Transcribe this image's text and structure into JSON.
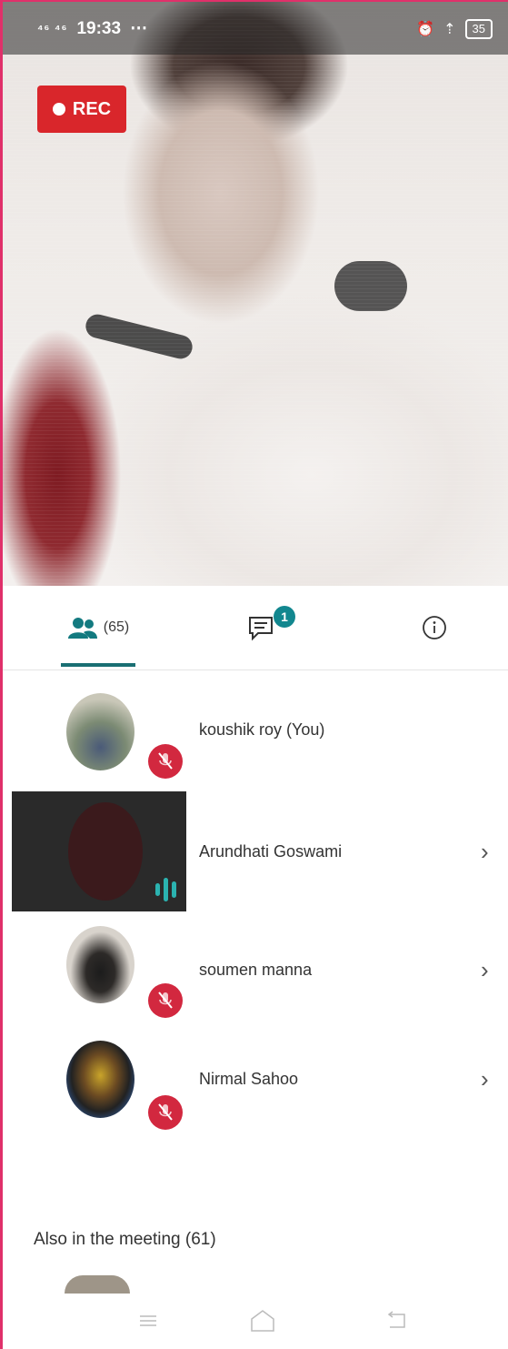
{
  "status_bar": {
    "signal": "⁴⁶ ⁴⁶",
    "time": "19:33",
    "battery": "35"
  },
  "recording": {
    "label": "REC"
  },
  "tabs": {
    "people_count": "(65)",
    "chat_badge": "1"
  },
  "participants": [
    {
      "name": "koushik roy (You)",
      "muted": true
    },
    {
      "name": "Arundhati Goswami",
      "speaking": true
    },
    {
      "name": "soumen manna",
      "muted": true
    },
    {
      "name": "Nirmal Sahoo",
      "muted": true
    }
  ],
  "also_in_meeting": "Also in the meeting (61)",
  "colors": {
    "accent": "#12878f",
    "rec": "#d9262b",
    "mute": "#d2283f"
  }
}
